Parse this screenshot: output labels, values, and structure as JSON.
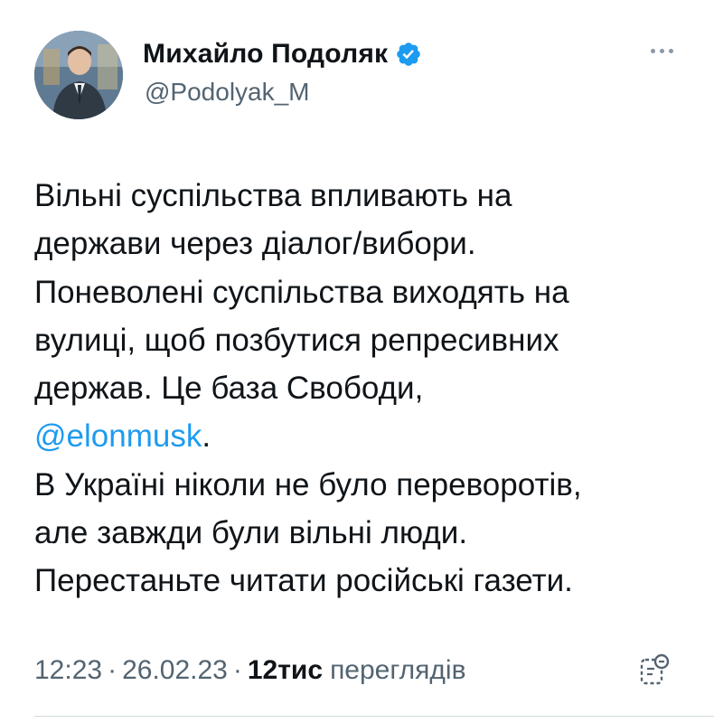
{
  "author": {
    "display_name": "Михайло Подоляк",
    "handle": "@Podolyak_M"
  },
  "tweet": {
    "lines": [
      {
        "text": "Вільні суспільства впливають на"
      },
      {
        "text": "держави через діалог/вибори."
      },
      {
        "text": "Поневолені суспільства виходять на"
      },
      {
        "text": "вулиці, щоб позбутися репресивних"
      },
      {
        "text": "держав. Це база Свободи,"
      },
      {
        "mention": "@elonmusk",
        "after": "."
      },
      {
        "text": "В Україні ніколи не було переворотів,"
      },
      {
        "text": "але завжди були вільні люди."
      },
      {
        "text": "Перестаньте читати російські газети."
      }
    ]
  },
  "meta": {
    "time": "12:23",
    "separator": "·",
    "date": "26.02.23",
    "views_count": "12тис",
    "views_label": "переглядів"
  },
  "colors": {
    "accent": "#1d9bf0",
    "text_primary": "#0f1419",
    "text_secondary": "#536471"
  },
  "icons": {
    "verified": "verified-badge-icon",
    "more": "more-dots-icon",
    "analytics": "analytics-icon"
  }
}
